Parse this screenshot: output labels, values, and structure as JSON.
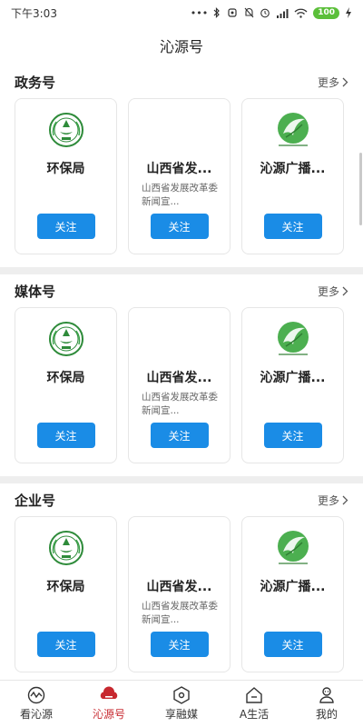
{
  "status_bar": {
    "time": "下午3:03",
    "dots": "•••",
    "battery": "100"
  },
  "page_title": "沁源号",
  "sections": [
    {
      "title": "政务号",
      "more": "更多",
      "cards": [
        {
          "name": "环保局",
          "desc": "",
          "follow": "关注",
          "logo": "environment-bureau-logo"
        },
        {
          "name": "山西省发...",
          "desc": "山西省发展改革委新闻宣...",
          "follow": "关注",
          "logo": ""
        },
        {
          "name": "沁源广播...",
          "desc": "",
          "follow": "关注",
          "logo": "qinyuan-broadcast-logo"
        }
      ]
    },
    {
      "title": "媒体号",
      "more": "更多",
      "cards": [
        {
          "name": "环保局",
          "desc": "",
          "follow": "关注",
          "logo": "environment-bureau-logo"
        },
        {
          "name": "山西省发...",
          "desc": "山西省发展改革委新闻宣...",
          "follow": "关注",
          "logo": ""
        },
        {
          "name": "沁源广播...",
          "desc": "",
          "follow": "关注",
          "logo": "qinyuan-broadcast-logo"
        }
      ]
    },
    {
      "title": "企业号",
      "more": "更多",
      "cards": [
        {
          "name": "环保局",
          "desc": "",
          "follow": "关注",
          "logo": "environment-bureau-logo"
        },
        {
          "name": "山西省发...",
          "desc": "山西省发展改革委新闻宣...",
          "follow": "关注",
          "logo": ""
        },
        {
          "name": "沁源广播...",
          "desc": "",
          "follow": "关注",
          "logo": "qinyuan-broadcast-logo"
        }
      ]
    }
  ],
  "tabs": [
    {
      "label": "看沁源",
      "icon": "wave-icon",
      "active": false
    },
    {
      "label": "沁源号",
      "icon": "cloud-icon",
      "active": true
    },
    {
      "label": "享融媒",
      "icon": "hexagon-icon",
      "active": false
    },
    {
      "label": "A生活",
      "icon": "house-icon",
      "active": false
    },
    {
      "label": "我的",
      "icon": "person-icon",
      "active": false
    }
  ],
  "colors": {
    "accent": "#c7282f",
    "button": "#1a8ce6"
  }
}
